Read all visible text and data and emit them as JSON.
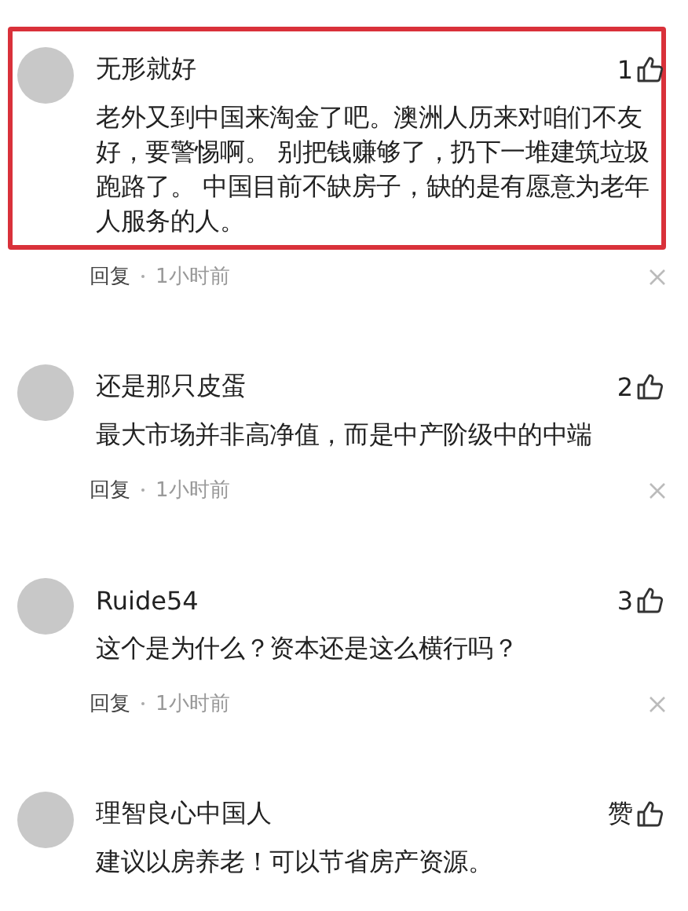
{
  "comments": [
    {
      "name": "无形就好",
      "likes": "1",
      "highlighted": true,
      "body": "老外又到中国来淘金了吧。澳洲人历来对咱们不友好，要警惕啊。 别把钱赚够了，扔下一堆建筑垃圾跑路了。 中国目前不缺房子，缺的是有愿意为老年人服务的人。",
      "reply": "回复",
      "time": "1小时前"
    },
    {
      "name": "还是那只皮蛋",
      "likes": "2",
      "highlighted": false,
      "body": "最大市场并非高净值，而是中产阶级中的中端",
      "reply": "回复",
      "time": "1小时前"
    },
    {
      "name": "Ruide54",
      "likes": "3",
      "highlighted": false,
      "body": "这个是为什么？资本还是这么横行吗？",
      "reply": "回复",
      "time": "1小时前"
    },
    {
      "name": "理智良心中国人",
      "likes": "赞",
      "highlighted": false,
      "body": "建议以房养老！可以节省房产资源。"
    }
  ]
}
